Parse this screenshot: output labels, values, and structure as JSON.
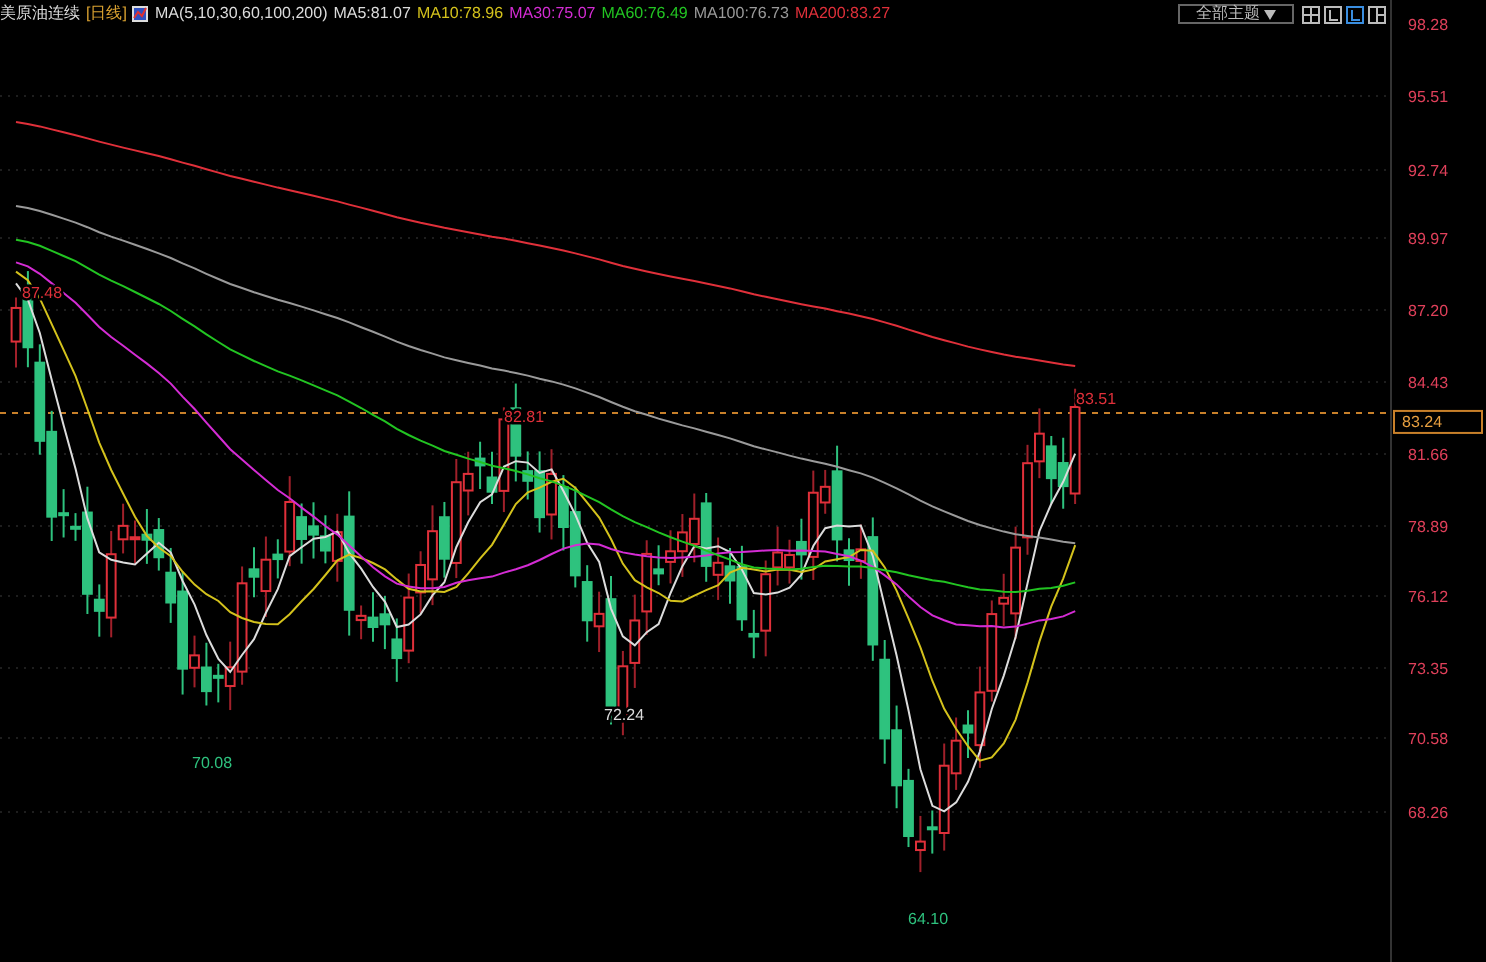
{
  "header": {
    "title": "美原油连续",
    "period": "[日线]",
    "indicator": "MA(5,10,30,60,100,200)",
    "ma_values": [
      {
        "label": "MA5:81.07",
        "color": "#dcdcdc"
      },
      {
        "label": "MA10:78.96",
        "color": "#d4c21c"
      },
      {
        "label": "MA30:75.07",
        "color": "#d42cd4"
      },
      {
        "label": "MA60:76.49",
        "color": "#22c422"
      },
      {
        "label": "MA100:76.73",
        "color": "#9a9a9a"
      },
      {
        "label": "MA200:83.27",
        "color": "#e0303a"
      }
    ]
  },
  "toolbar": {
    "theme_dropdown": "全部主题"
  },
  "price_axis": {
    "ticks": [
      "98.28",
      "95.51",
      "92.74",
      "89.97",
      "87.20",
      "84.43",
      "81.66",
      "78.89",
      "76.12",
      "73.35",
      "70.58",
      "68.26"
    ],
    "current_price": "83.24"
  },
  "annotations": [
    {
      "text": "87.48",
      "color": "#e0303a"
    },
    {
      "text": "82.81",
      "color": "#e0303a"
    },
    {
      "text": "70.08",
      "color": "#2ec27e"
    },
    {
      "text": "72.24",
      "color": "#dcdcdc"
    },
    {
      "text": "64.10",
      "color": "#2ec27e"
    },
    {
      "text": "83.51",
      "color": "#e0303a"
    }
  ]
}
